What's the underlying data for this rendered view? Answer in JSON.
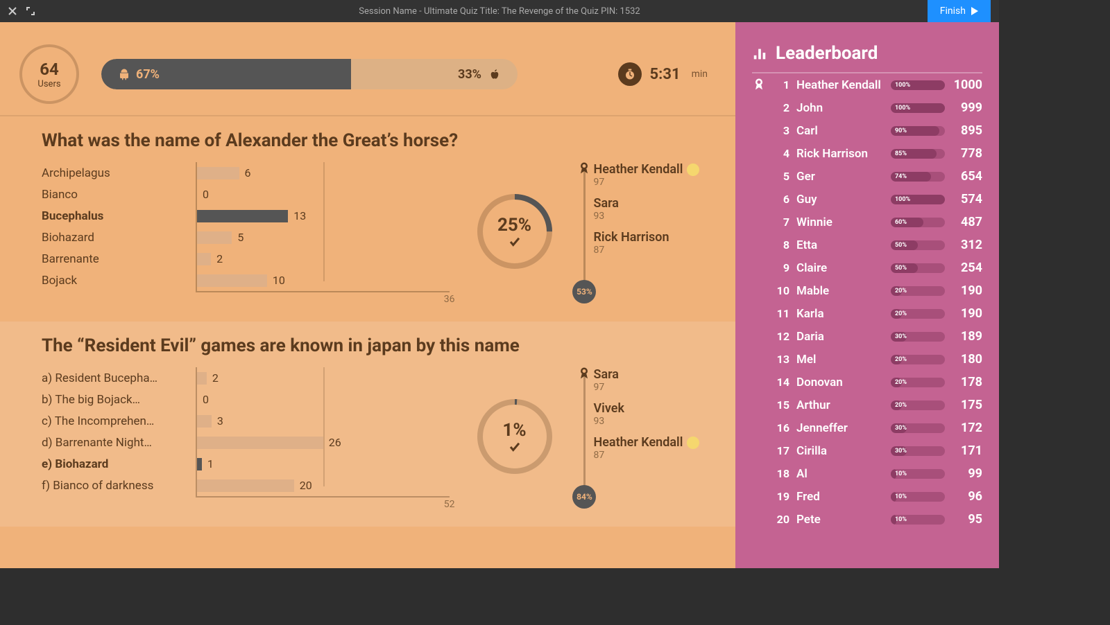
{
  "titlebar": {
    "title": "Session Name  -  Ultimate Quiz Title: The Revenge of the Quiz       PIN: 1532",
    "finish_label": "Finish"
  },
  "stats": {
    "users_count": "64",
    "users_label": "Users",
    "android_pct": "67%",
    "apple_pct": "33%",
    "timer_value": "5:31",
    "timer_unit": "min"
  },
  "leaderboard": {
    "title": "Leaderboard",
    "rows": [
      {
        "rank": "1",
        "name": "Heather Kendall",
        "face": true,
        "pct": "100%",
        "pctVal": 100,
        "score": "1000",
        "medal": true
      },
      {
        "rank": "2",
        "name": "John",
        "face": false,
        "pct": "100%",
        "pctVal": 100,
        "score": "999",
        "medal": false
      },
      {
        "rank": "3",
        "name": "Carl",
        "face": false,
        "pct": "90%",
        "pctVal": 90,
        "score": "895",
        "medal": false
      },
      {
        "rank": "4",
        "name": "Rick Harrison",
        "face": false,
        "pct": "85%",
        "pctVal": 85,
        "score": "778",
        "medal": false
      },
      {
        "rank": "5",
        "name": "Ger",
        "face": false,
        "pct": "74%",
        "pctVal": 74,
        "score": "654",
        "medal": false
      },
      {
        "rank": "6",
        "name": "Guy",
        "face": false,
        "pct": "100%",
        "pctVal": 100,
        "score": "574",
        "medal": false
      },
      {
        "rank": "7",
        "name": "Winnie",
        "face": false,
        "pct": "60%",
        "pctVal": 60,
        "score": "487",
        "medal": false
      },
      {
        "rank": "8",
        "name": "Etta",
        "face": false,
        "pct": "50%",
        "pctVal": 50,
        "score": "312",
        "medal": false
      },
      {
        "rank": "9",
        "name": "Claire",
        "face": false,
        "pct": "50%",
        "pctVal": 50,
        "score": "254",
        "medal": false
      },
      {
        "rank": "10",
        "name": "Mable",
        "face": false,
        "pct": "20%",
        "pctVal": 20,
        "score": "190",
        "medal": false
      },
      {
        "rank": "11",
        "name": "Karla",
        "face": false,
        "pct": "20%",
        "pctVal": 20,
        "score": "190",
        "medal": false
      },
      {
        "rank": "12",
        "name": "Daria",
        "face": false,
        "pct": "30%",
        "pctVal": 30,
        "score": "189",
        "medal": false
      },
      {
        "rank": "13",
        "name": "Mel",
        "face": false,
        "pct": "20%",
        "pctVal": 20,
        "score": "180",
        "medal": false
      },
      {
        "rank": "14",
        "name": "Donovan",
        "face": false,
        "pct": "20%",
        "pctVal": 20,
        "score": "178",
        "medal": false
      },
      {
        "rank": "15",
        "name": "Arthur",
        "face": false,
        "pct": "20%",
        "pctVal": 20,
        "score": "175",
        "medal": false
      },
      {
        "rank": "16",
        "name": "Jenneffer",
        "face": false,
        "pct": "30%",
        "pctVal": 30,
        "score": "172",
        "medal": false
      },
      {
        "rank": "17",
        "name": "Cirilla",
        "face": false,
        "pct": "30%",
        "pctVal": 30,
        "score": "171",
        "medal": false
      },
      {
        "rank": "18",
        "name": "Al",
        "face": false,
        "pct": "10%",
        "pctVal": 10,
        "score": "99",
        "medal": false
      },
      {
        "rank": "19",
        "name": "Fred",
        "face": false,
        "pct": "10%",
        "pctVal": 10,
        "score": "96",
        "medal": false
      },
      {
        "rank": "20",
        "name": "Pete",
        "face": false,
        "pct": "10%",
        "pctVal": 10,
        "score": "95",
        "medal": false
      }
    ]
  },
  "questions": [
    {
      "title": "What was the name of Alexander the Great’s horse?",
      "ring_pct": "25%",
      "ring_val": 25,
      "top3_pct": "53%",
      "chart_max": "36",
      "answers": [
        {
          "label": "Archipelagus",
          "count": "6",
          "countVal": 6,
          "correct": false
        },
        {
          "label": "Bianco",
          "count": "0",
          "countVal": 0,
          "correct": false
        },
        {
          "label": "Bucephalus",
          "count": "13",
          "countVal": 13,
          "correct": true
        },
        {
          "label": "Biohazard",
          "count": "5",
          "countVal": 5,
          "correct": false
        },
        {
          "label": "Barrenante",
          "count": "2",
          "countVal": 2,
          "correct": false
        },
        {
          "label": "Bojack",
          "count": "10",
          "countVal": 10,
          "correct": false
        }
      ],
      "top3": [
        {
          "name": "Heather Kendall",
          "score": "97",
          "face": true
        },
        {
          "name": "Sara",
          "score": "93",
          "face": false
        },
        {
          "name": "Rick Harrison",
          "score": "87",
          "face": false
        }
      ]
    },
    {
      "title": "The “Resident Evil” games are known in japan by this name",
      "ring_pct": "1%",
      "ring_val": 1,
      "top3_pct": "84%",
      "chart_max": "52",
      "answers": [
        {
          "label": "a) Resident Bucepha…",
          "count": "2",
          "countVal": 2,
          "correct": false
        },
        {
          "label": "b) The big Bojack…",
          "count": "0",
          "countVal": 0,
          "correct": false
        },
        {
          "label": "c) The Incomprehen…",
          "count": "3",
          "countVal": 3,
          "correct": false
        },
        {
          "label": "d) Barrenante Night…",
          "count": "26",
          "countVal": 26,
          "correct": false
        },
        {
          "label": "e) Biohazard",
          "count": "1",
          "countVal": 1,
          "correct": true
        },
        {
          "label": "f) Bianco of darkness",
          "count": "20",
          "countVal": 20,
          "correct": false
        }
      ],
      "top3": [
        {
          "name": "Sara",
          "score": "97",
          "face": false
        },
        {
          "name": "Vivek",
          "score": "93",
          "face": false
        },
        {
          "name": "Heather Kendall",
          "score": "87",
          "face": true
        }
      ]
    }
  ],
  "chart_data": [
    {
      "type": "bar",
      "title": "What was the name of Alexander the Great’s horse?",
      "categories": [
        "Archipelagus",
        "Bianco",
        "Bucephalus",
        "Biohazard",
        "Barrenante",
        "Bojack"
      ],
      "values": [
        6,
        0,
        13,
        5,
        2,
        10
      ],
      "correct_index": 2,
      "xlim": [
        0,
        36
      ],
      "correct_ratio_pct": 25,
      "fastest_user_answered_pct": 53
    },
    {
      "type": "bar",
      "title": "The “Resident Evil” games are known in japan by this name",
      "categories": [
        "a) Resident Bucepha…",
        "b) The big Bojack…",
        "c) The Incomprehen…",
        "d) Barrenante Night…",
        "e) Biohazard",
        "f) Bianco of darkness"
      ],
      "values": [
        2,
        0,
        3,
        26,
        1,
        20
      ],
      "correct_index": 4,
      "xlim": [
        0,
        52
      ],
      "correct_ratio_pct": 1,
      "fastest_user_answered_pct": 84
    }
  ]
}
